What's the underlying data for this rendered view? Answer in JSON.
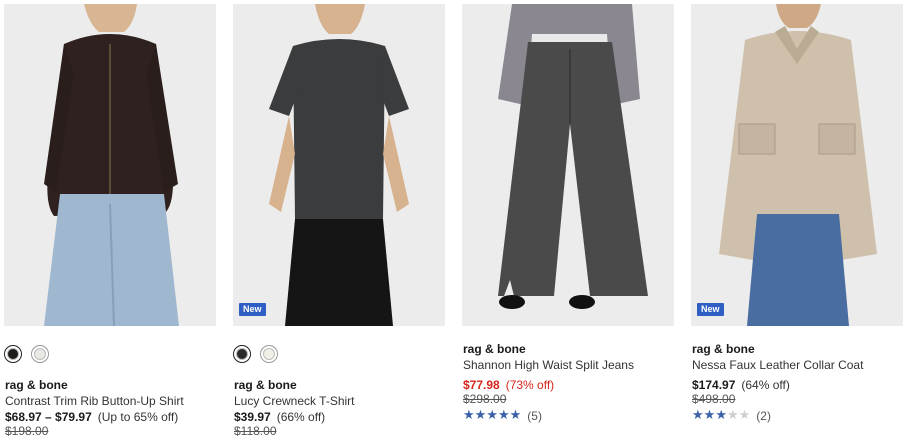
{
  "products": [
    {
      "brand": "rag & bone",
      "name": "Contrast Trim Rib Button-Up Shirt",
      "price": "$68.97 – $79.97",
      "discount": "(Up to 65% off)",
      "original_price": "$198.00",
      "swatches": [
        "#1f1b1a",
        "#e9e9e4"
      ],
      "selected_swatch": 0
    },
    {
      "brand": "rag & bone",
      "name": "Lucy Crewneck T-Shirt",
      "badge": "New",
      "price": "$39.97",
      "discount": "(66% off)",
      "original_price": "$118.00",
      "swatches": [
        "#2a2a2a",
        "#f1f0e6"
      ],
      "selected_swatch": 0
    },
    {
      "brand": "rag & bone",
      "name": "Shannon High Waist Split Jeans",
      "price": "$77.98",
      "discount": "(73% off)",
      "original_price": "$298.00",
      "rating_value": 4.5,
      "rating_count": "(5)",
      "price_color": "#d8261b"
    },
    {
      "brand": "rag & bone",
      "name": "Nessa Faux Leather Collar Coat",
      "badge": "New",
      "price": "$174.97",
      "discount": "(64% off)",
      "original_price": "$498.00",
      "rating_value": 3,
      "rating_count": "(2)"
    }
  ],
  "icons": {
    "star": "star-icon",
    "star_rating_color": "#3a61a8",
    "badge_color": "#2f5fc4"
  }
}
